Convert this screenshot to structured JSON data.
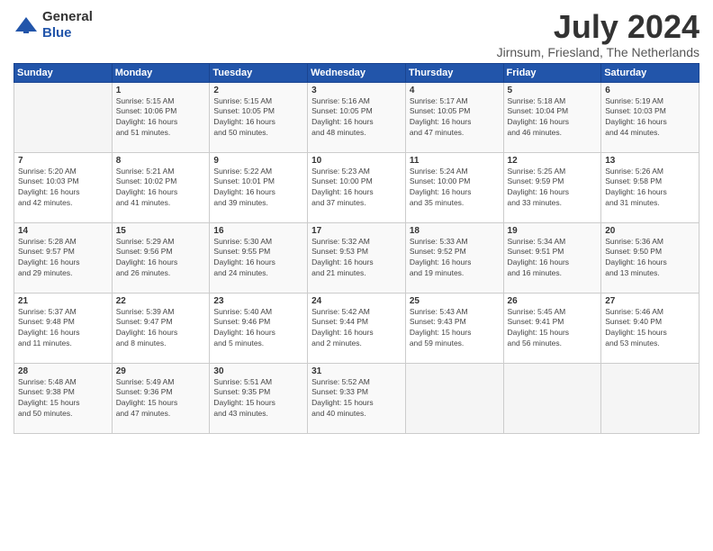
{
  "header": {
    "logo_general": "General",
    "logo_blue": "Blue",
    "title": "July 2024",
    "location": "Jirnsum, Friesland, The Netherlands"
  },
  "days_of_week": [
    "Sunday",
    "Monday",
    "Tuesday",
    "Wednesday",
    "Thursday",
    "Friday",
    "Saturday"
  ],
  "weeks": [
    [
      {
        "day": "",
        "info": ""
      },
      {
        "day": "1",
        "info": "Sunrise: 5:15 AM\nSunset: 10:06 PM\nDaylight: 16 hours\nand 51 minutes."
      },
      {
        "day": "2",
        "info": "Sunrise: 5:15 AM\nSunset: 10:05 PM\nDaylight: 16 hours\nand 50 minutes."
      },
      {
        "day": "3",
        "info": "Sunrise: 5:16 AM\nSunset: 10:05 PM\nDaylight: 16 hours\nand 48 minutes."
      },
      {
        "day": "4",
        "info": "Sunrise: 5:17 AM\nSunset: 10:05 PM\nDaylight: 16 hours\nand 47 minutes."
      },
      {
        "day": "5",
        "info": "Sunrise: 5:18 AM\nSunset: 10:04 PM\nDaylight: 16 hours\nand 46 minutes."
      },
      {
        "day": "6",
        "info": "Sunrise: 5:19 AM\nSunset: 10:03 PM\nDaylight: 16 hours\nand 44 minutes."
      }
    ],
    [
      {
        "day": "7",
        "info": "Sunrise: 5:20 AM\nSunset: 10:03 PM\nDaylight: 16 hours\nand 42 minutes."
      },
      {
        "day": "8",
        "info": "Sunrise: 5:21 AM\nSunset: 10:02 PM\nDaylight: 16 hours\nand 41 minutes."
      },
      {
        "day": "9",
        "info": "Sunrise: 5:22 AM\nSunset: 10:01 PM\nDaylight: 16 hours\nand 39 minutes."
      },
      {
        "day": "10",
        "info": "Sunrise: 5:23 AM\nSunset: 10:00 PM\nDaylight: 16 hours\nand 37 minutes."
      },
      {
        "day": "11",
        "info": "Sunrise: 5:24 AM\nSunset: 10:00 PM\nDaylight: 16 hours\nand 35 minutes."
      },
      {
        "day": "12",
        "info": "Sunrise: 5:25 AM\nSunset: 9:59 PM\nDaylight: 16 hours\nand 33 minutes."
      },
      {
        "day": "13",
        "info": "Sunrise: 5:26 AM\nSunset: 9:58 PM\nDaylight: 16 hours\nand 31 minutes."
      }
    ],
    [
      {
        "day": "14",
        "info": "Sunrise: 5:28 AM\nSunset: 9:57 PM\nDaylight: 16 hours\nand 29 minutes."
      },
      {
        "day": "15",
        "info": "Sunrise: 5:29 AM\nSunset: 9:56 PM\nDaylight: 16 hours\nand 26 minutes."
      },
      {
        "day": "16",
        "info": "Sunrise: 5:30 AM\nSunset: 9:55 PM\nDaylight: 16 hours\nand 24 minutes."
      },
      {
        "day": "17",
        "info": "Sunrise: 5:32 AM\nSunset: 9:53 PM\nDaylight: 16 hours\nand 21 minutes."
      },
      {
        "day": "18",
        "info": "Sunrise: 5:33 AM\nSunset: 9:52 PM\nDaylight: 16 hours\nand 19 minutes."
      },
      {
        "day": "19",
        "info": "Sunrise: 5:34 AM\nSunset: 9:51 PM\nDaylight: 16 hours\nand 16 minutes."
      },
      {
        "day": "20",
        "info": "Sunrise: 5:36 AM\nSunset: 9:50 PM\nDaylight: 16 hours\nand 13 minutes."
      }
    ],
    [
      {
        "day": "21",
        "info": "Sunrise: 5:37 AM\nSunset: 9:48 PM\nDaylight: 16 hours\nand 11 minutes."
      },
      {
        "day": "22",
        "info": "Sunrise: 5:39 AM\nSunset: 9:47 PM\nDaylight: 16 hours\nand 8 minutes."
      },
      {
        "day": "23",
        "info": "Sunrise: 5:40 AM\nSunset: 9:46 PM\nDaylight: 16 hours\nand 5 minutes."
      },
      {
        "day": "24",
        "info": "Sunrise: 5:42 AM\nSunset: 9:44 PM\nDaylight: 16 hours\nand 2 minutes."
      },
      {
        "day": "25",
        "info": "Sunrise: 5:43 AM\nSunset: 9:43 PM\nDaylight: 15 hours\nand 59 minutes."
      },
      {
        "day": "26",
        "info": "Sunrise: 5:45 AM\nSunset: 9:41 PM\nDaylight: 15 hours\nand 56 minutes."
      },
      {
        "day": "27",
        "info": "Sunrise: 5:46 AM\nSunset: 9:40 PM\nDaylight: 15 hours\nand 53 minutes."
      }
    ],
    [
      {
        "day": "28",
        "info": "Sunrise: 5:48 AM\nSunset: 9:38 PM\nDaylight: 15 hours\nand 50 minutes."
      },
      {
        "day": "29",
        "info": "Sunrise: 5:49 AM\nSunset: 9:36 PM\nDaylight: 15 hours\nand 47 minutes."
      },
      {
        "day": "30",
        "info": "Sunrise: 5:51 AM\nSunset: 9:35 PM\nDaylight: 15 hours\nand 43 minutes."
      },
      {
        "day": "31",
        "info": "Sunrise: 5:52 AM\nSunset: 9:33 PM\nDaylight: 15 hours\nand 40 minutes."
      },
      {
        "day": "",
        "info": ""
      },
      {
        "day": "",
        "info": ""
      },
      {
        "day": "",
        "info": ""
      }
    ]
  ]
}
